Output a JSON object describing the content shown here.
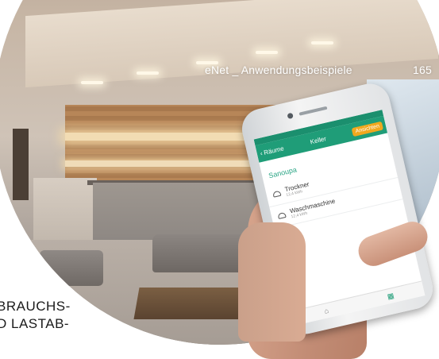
{
  "page_header": {
    "title": "eNet _ Anwendungsbeispiele",
    "page_number": "165"
  },
  "app": {
    "back_label": "Räume",
    "room_title": "Keller",
    "right_button": "Ansichten",
    "section_title": "Sanoupa",
    "devices": [
      {
        "name": "Trockner",
        "sub": "12,4 kWh"
      },
      {
        "name": "Waschmaschine",
        "sub": "12,4 kWh"
      }
    ],
    "accent_color": "#1f9d78",
    "tab_icons": [
      "home-icon",
      "grid-icon"
    ]
  },
  "body_text": {
    "line1": "BRAUCHS-",
    "line2": "D LASTAB-"
  }
}
